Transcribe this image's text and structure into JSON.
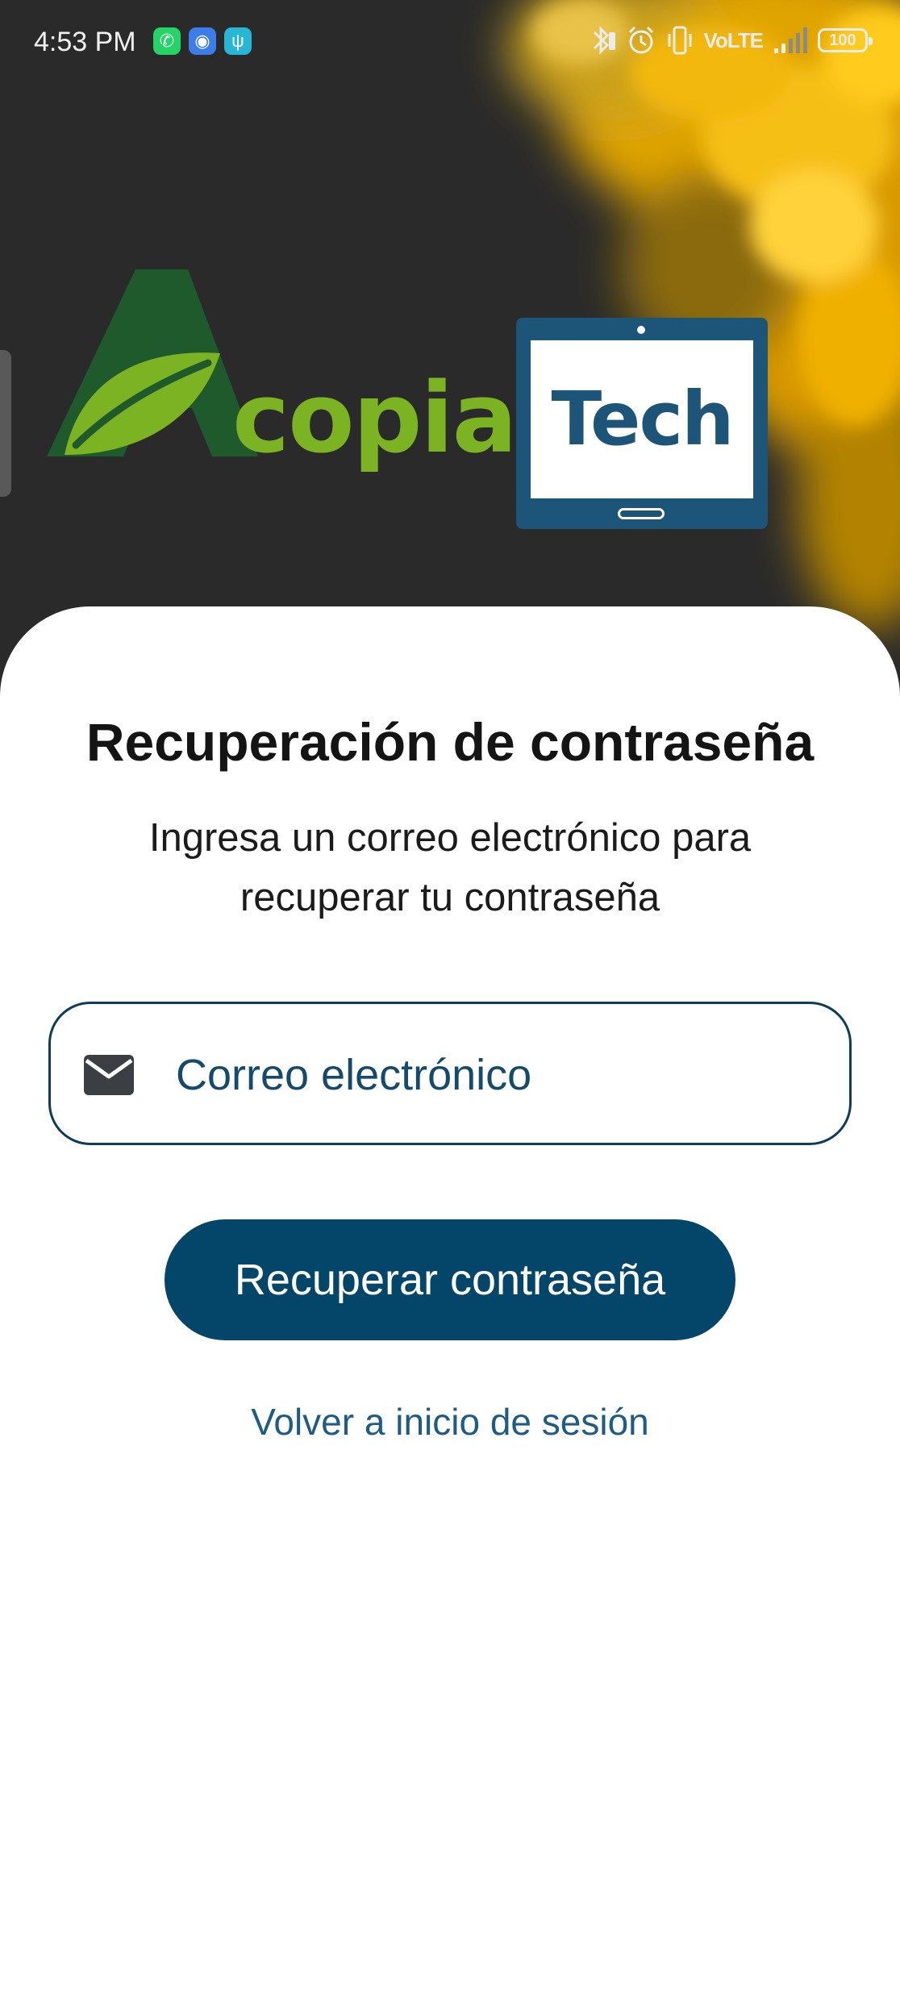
{
  "status_bar": {
    "time": "4:53 PM",
    "notification_icons": [
      "whatsapp-icon",
      "messages-icon",
      "usb-icon"
    ],
    "system_icons": [
      "bluetooth-icon",
      "alarm-icon",
      "vibrate-icon",
      "volte-icon",
      "signal-icon",
      "battery-icon"
    ],
    "volte_label": "VoLTE",
    "battery_level": "100"
  },
  "header": {
    "logo_text_acopia": "copia",
    "logo_text_tech": "Tech",
    "colors": {
      "background": "#2a2a2a",
      "smoke": "#f4b400",
      "acopia_dark_green": "#1f5a2c",
      "acopia_light_green": "#7cb322",
      "tech_blue": "#1c5577"
    }
  },
  "recovery": {
    "title": "Recuperación de contraseña",
    "subtitle": "Ingresa un correo electrónico para recuperar tu contraseña",
    "email_field": {
      "placeholder": "Correo electrónico",
      "value": "",
      "icon": "mail-icon"
    },
    "submit_label": "Recuperar contraseña",
    "back_link": "Volver a inicio de sesión",
    "colors": {
      "primary": "#03466a",
      "link": "#1f5c84",
      "text": "#141414"
    }
  }
}
